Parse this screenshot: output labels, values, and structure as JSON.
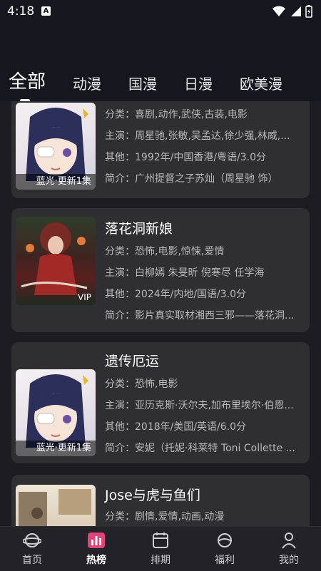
{
  "status": {
    "time": "4:18",
    "app_badge": "A"
  },
  "tabs": [
    {
      "label": "全部",
      "active": true
    },
    {
      "label": "动漫"
    },
    {
      "label": "国漫"
    },
    {
      "label": "日漫"
    },
    {
      "label": "欧美漫"
    }
  ],
  "cards": [
    {
      "badge": "蓝光·更新1集",
      "genre": "分类：喜剧,动作,武侠,古装,电影",
      "cast": "主演：周星驰,张敏,吴孟达,徐少强,林威,...",
      "other": "其他：1992年/中国香港/粤语/3.0分",
      "intro": "简介：广州提督之子苏灿（周星驰 饰）"
    },
    {
      "title": "落花洞新娘",
      "badge": "VIP",
      "genre": "分类：恐怖,电影,惊悚,爱情",
      "cast": "主演：白柳嫣 朱旻昕 倪寒尽 任学海",
      "other": "其他：2024年/内地/国语/3.0分",
      "intro": "简介：影片真实取材湘西三邪——落花洞..."
    },
    {
      "title": "遗传厄运",
      "badge": "蓝光·更新1集",
      "genre": "分类：恐怖,电影",
      "cast": "主演：亚历克斯·沃尔夫,加布里埃尔·伯恩...",
      "other": "其他：2018年/美国/英语/6.0分",
      "intro": "简介：安妮（托妮·科莱特 Toni Collette ..."
    },
    {
      "title": "Jose与虎与鱼们",
      "genre": "分类：剧情,爱情,动画,动漫"
    }
  ],
  "nav": [
    {
      "label": "首页",
      "icon": "home-planet-icon"
    },
    {
      "label": "热榜",
      "icon": "chart-icon",
      "active": true
    },
    {
      "label": "排期",
      "icon": "calendar-icon"
    },
    {
      "label": "福利",
      "icon": "gift-icon"
    },
    {
      "label": "我的",
      "icon": "user-icon"
    }
  ]
}
